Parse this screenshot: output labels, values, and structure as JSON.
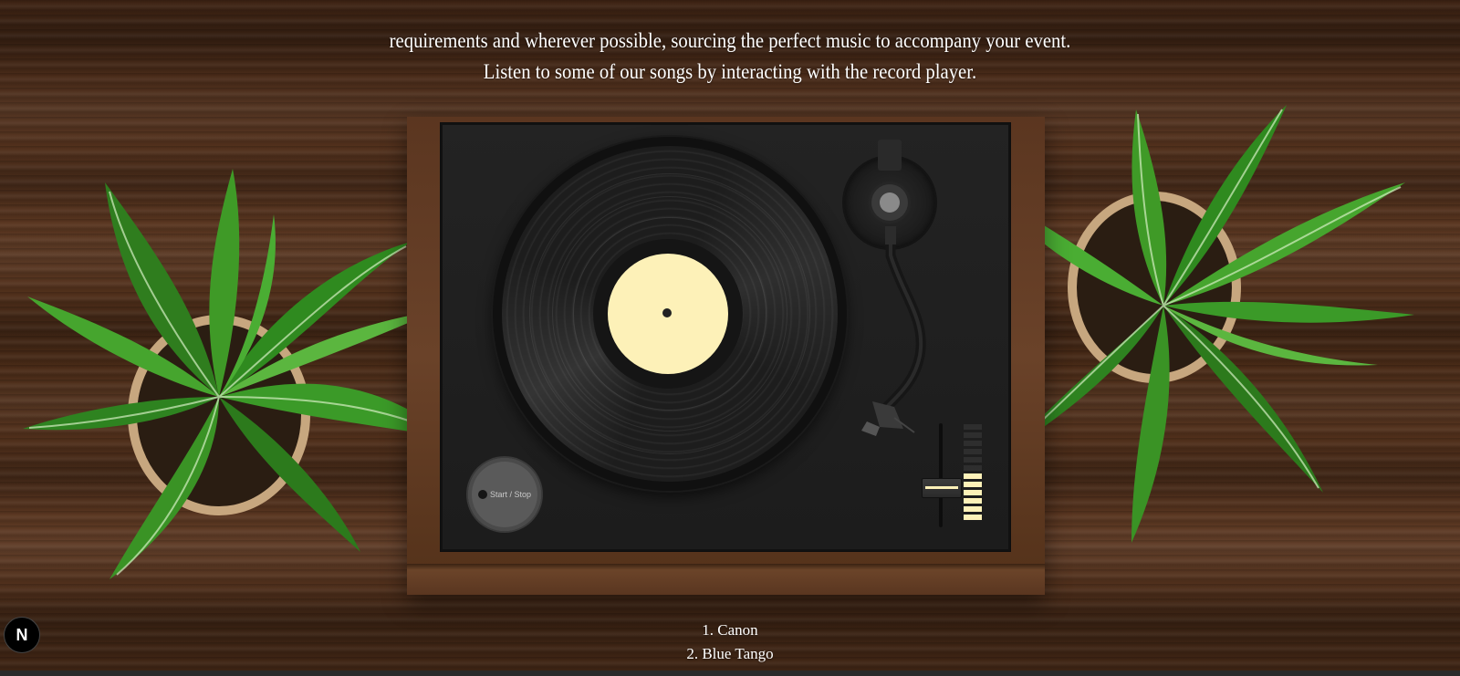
{
  "intro": {
    "line_1": "requirements and wherever possible, sourcing the perfect music to accompany your event.",
    "line_2": "Listen to some of our songs by interacting with the record player."
  },
  "player": {
    "start_stop_label": "Start / Stop",
    "accent_color": "#fdf1b8",
    "pitch_level": 0.55,
    "level_meter_active": 6,
    "level_meter_total": 12
  },
  "playlist": {
    "tracks": [
      {
        "label": "1. Canon"
      },
      {
        "label": "2. Blue Tango"
      }
    ]
  },
  "badge": {
    "label": "N",
    "icon": "nextjs-icon"
  }
}
